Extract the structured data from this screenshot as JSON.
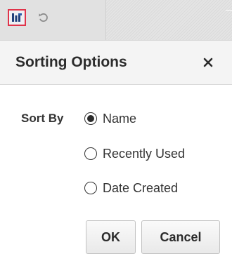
{
  "toolbar": {
    "active_tool_icon": "sort-icon",
    "second_tool_icon": "undo-icon",
    "accent_color": "#e0344a",
    "icon_color": "#1f3f7a"
  },
  "dialog": {
    "title": "Sorting Options",
    "close_label": "✕",
    "sort_by_label": "Sort By",
    "options": [
      {
        "label": "Name",
        "selected": true
      },
      {
        "label": "Recently Used",
        "selected": false
      },
      {
        "label": "Date Created",
        "selected": false
      }
    ],
    "ok_label": "OK",
    "cancel_label": "Cancel"
  }
}
